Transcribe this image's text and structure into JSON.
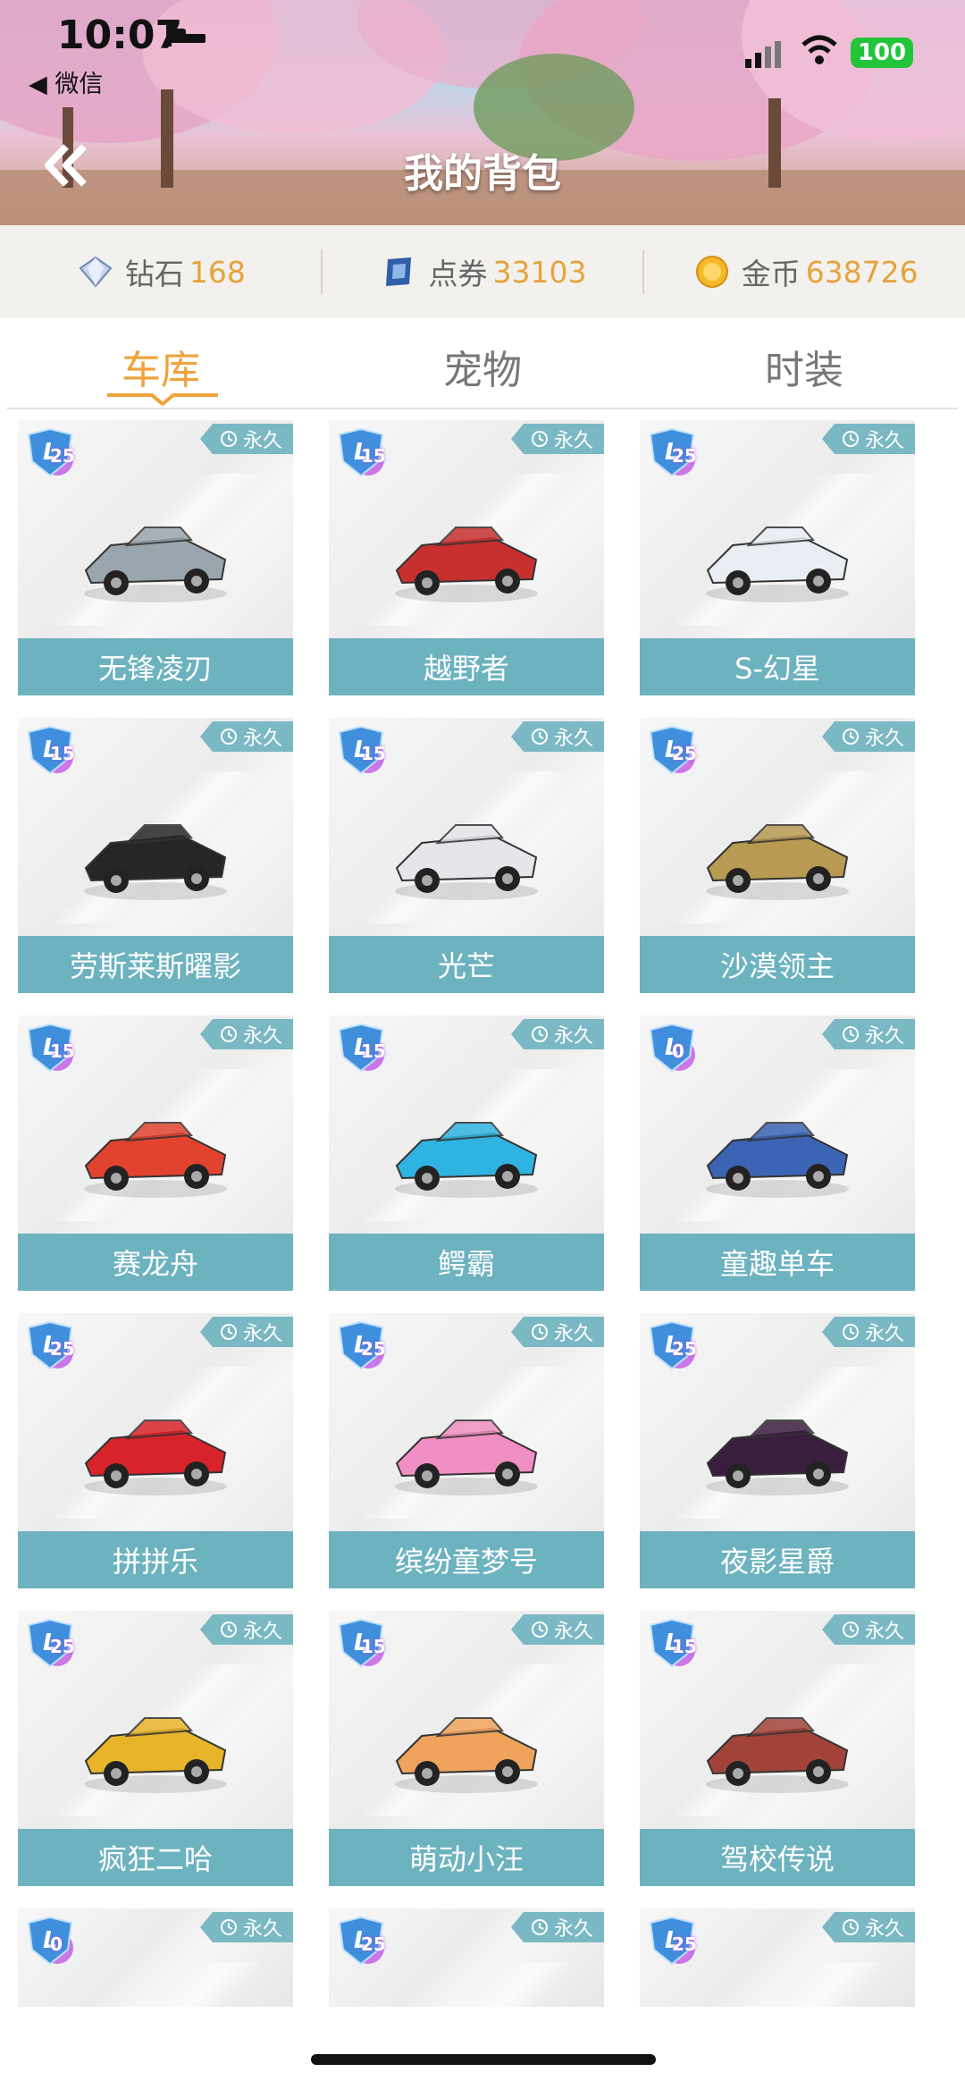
{
  "status_bar": {
    "time": "10:07",
    "back_app": "◀ 微信",
    "battery": "100"
  },
  "header": {
    "title": "我的背包"
  },
  "currencies": [
    {
      "label": "钻石",
      "value": "168"
    },
    {
      "label": "点券",
      "value": "33103"
    },
    {
      "label": "金币",
      "value": "638726"
    }
  ],
  "tabs": [
    {
      "label": "车库"
    },
    {
      "label": "宠物"
    },
    {
      "label": "时装"
    }
  ],
  "items": [
    {
      "name": "无锋凌刃",
      "level": "25",
      "permanent": "永久",
      "color": "#9aa6ad"
    },
    {
      "name": "越野者",
      "level": "15",
      "permanent": "永久",
      "color": "#c7302f"
    },
    {
      "name": "S-幻星",
      "level": "25",
      "permanent": "永久",
      "color": "#e9eef5"
    },
    {
      "name": "劳斯莱斯曜影",
      "level": "15",
      "permanent": "永久",
      "color": "#262626"
    },
    {
      "name": "光芒",
      "level": "15",
      "permanent": "永久",
      "color": "#e6e6ea"
    },
    {
      "name": "沙漠领主",
      "level": "25",
      "permanent": "永久",
      "color": "#b99a52"
    },
    {
      "name": "赛龙舟",
      "level": "15",
      "permanent": "永久",
      "color": "#e2432f"
    },
    {
      "name": "鳄霸",
      "level": "15",
      "permanent": "永久",
      "color": "#2fb3e0"
    },
    {
      "name": "童趣单车",
      "level": "0",
      "permanent": "永久",
      "color": "#3b64b5"
    },
    {
      "name": "拼拼乐",
      "level": "25",
      "permanent": "永久",
      "color": "#d8232a"
    },
    {
      "name": "缤纷童梦号",
      "level": "25",
      "permanent": "永久",
      "color": "#f08fc3"
    },
    {
      "name": "夜影星爵",
      "level": "25",
      "permanent": "永久",
      "color": "#3a1e3e"
    },
    {
      "name": "疯狂二哈",
      "level": "25",
      "permanent": "永久",
      "color": "#e8b429"
    },
    {
      "name": "萌动小汪",
      "level": "15",
      "permanent": "永久",
      "color": "#f0a35c"
    },
    {
      "name": "驾校传说",
      "level": "15",
      "permanent": "永久",
      "color": "#a2433a"
    },
    {
      "name": "",
      "level": "0",
      "permanent": "永久",
      "color": "#cfd9e6"
    },
    {
      "name": "",
      "level": "25",
      "permanent": "永久",
      "color": "#cfd9e6"
    },
    {
      "name": "",
      "level": "25",
      "permanent": "永久",
      "color": "#cfd9e6"
    }
  ]
}
